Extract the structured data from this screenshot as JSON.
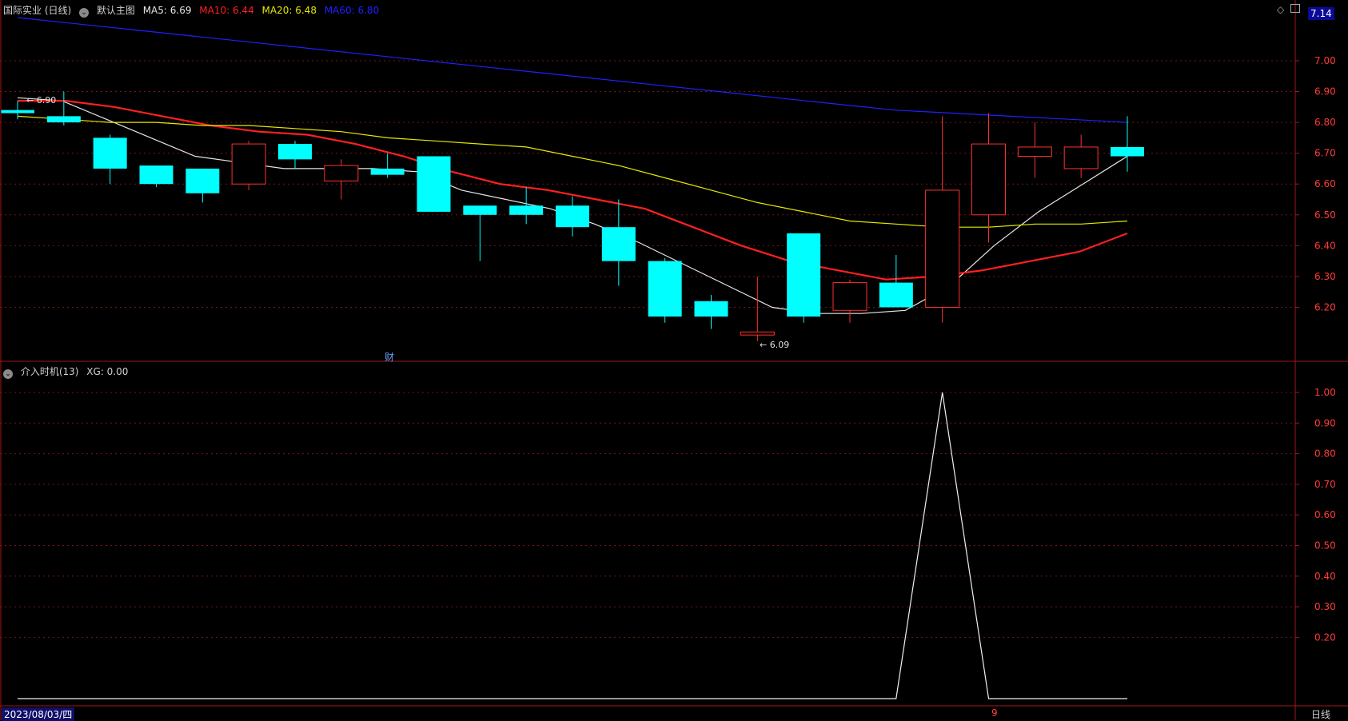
{
  "header": {
    "stock_label": "国际实业 (日线)",
    "main_label": "默认主图",
    "ma_items": [
      {
        "label": "MA5: 6.69",
        "color": "#e6e6e6"
      },
      {
        "label": "MA10: 6.44",
        "color": "#ff2020"
      },
      {
        "label": "MA20: 6.48",
        "color": "#e8e800"
      },
      {
        "label": "MA60: 6.80",
        "color": "#2020ff"
      }
    ],
    "corner_price": "7.14",
    "diamond_icon": "diamond-icon",
    "restore_icon": "window-restore-icon",
    "dropdown_icon": "chevron-down-icon"
  },
  "sub_header": {
    "indicator_label": "介入时机(13)",
    "xg_label": "XG: 0.00"
  },
  "footer": {
    "start_date": "2023/08/03/四",
    "month_marker": "9",
    "period_label": "日线"
  },
  "annotations": {
    "high_label": "6.90",
    "low_label": "6.09",
    "finance_marker": "财"
  },
  "colors": {
    "up": "#ff3030",
    "down": "#00ffff",
    "grid": "#7a1414",
    "axis": "#a01818",
    "ma5": "#e6e6e6",
    "ma10": "#ff2020",
    "ma20": "#e8e800",
    "ma60": "#2020ff"
  },
  "chart_data": [
    {
      "type": "candlestick",
      "title": "国际实业 (日线)",
      "ylim": [
        6.03,
        7.14
      ],
      "y_ticks": [
        6.2,
        6.3,
        6.4,
        6.5,
        6.6,
        6.7,
        6.8,
        6.9,
        7.0
      ],
      "candles": [
        {
          "o": 6.84,
          "h": 6.87,
          "l": 6.81,
          "c": 6.83
        },
        {
          "o": 6.82,
          "h": 6.9,
          "l": 6.79,
          "c": 6.8
        },
        {
          "o": 6.75,
          "h": 6.76,
          "l": 6.6,
          "c": 6.65
        },
        {
          "o": 6.66,
          "h": 6.66,
          "l": 6.59,
          "c": 6.6
        },
        {
          "o": 6.65,
          "h": 6.65,
          "l": 6.54,
          "c": 6.57
        },
        {
          "o": 6.6,
          "h": 6.74,
          "l": 6.58,
          "c": 6.73
        },
        {
          "o": 6.73,
          "h": 6.74,
          "l": 6.65,
          "c": 6.68
        },
        {
          "o": 6.61,
          "h": 6.68,
          "l": 6.55,
          "c": 6.66
        },
        {
          "o": 6.65,
          "h": 6.7,
          "l": 6.62,
          "c": 6.63
        },
        {
          "o": 6.69,
          "h": 6.69,
          "l": 6.51,
          "c": 6.51
        },
        {
          "o": 6.53,
          "h": 6.53,
          "l": 6.35,
          "c": 6.5
        },
        {
          "o": 6.53,
          "h": 6.59,
          "l": 6.47,
          "c": 6.5
        },
        {
          "o": 6.53,
          "h": 6.56,
          "l": 6.43,
          "c": 6.46
        },
        {
          "o": 6.46,
          "h": 6.55,
          "l": 6.27,
          "c": 6.35
        },
        {
          "o": 6.35,
          "h": 6.36,
          "l": 6.15,
          "c": 6.17
        },
        {
          "o": 6.22,
          "h": 6.24,
          "l": 6.13,
          "c": 6.17
        },
        {
          "o": 6.11,
          "h": 6.3,
          "l": 6.09,
          "c": 6.12
        },
        {
          "o": 6.44,
          "h": 6.44,
          "l": 6.15,
          "c": 6.17
        },
        {
          "o": 6.19,
          "h": 6.29,
          "l": 6.15,
          "c": 6.28
        },
        {
          "o": 6.28,
          "h": 6.37,
          "l": 6.2,
          "c": 6.2
        },
        {
          "o": 6.2,
          "h": 6.82,
          "l": 6.15,
          "c": 6.58
        },
        {
          "o": 6.5,
          "h": 6.83,
          "l": 6.41,
          "c": 6.73
        },
        {
          "o": 6.69,
          "h": 6.8,
          "l": 6.62,
          "c": 6.72
        },
        {
          "o": 6.65,
          "h": 6.76,
          "l": 6.62,
          "c": 6.72
        },
        {
          "o": 6.72,
          "h": 6.82,
          "l": 6.64,
          "c": 6.69
        }
      ],
      "series": [
        {
          "name": "MA5",
          "values": [
            6.88,
            6.87,
            6.81,
            6.75,
            6.69,
            6.67,
            6.65,
            6.65,
            6.65,
            6.64,
            6.58,
            6.55,
            6.52,
            6.47,
            6.41,
            6.34,
            6.27,
            6.2,
            6.18,
            6.18,
            6.19,
            6.27,
            6.4,
            6.51,
            6.6,
            6.69
          ]
        },
        {
          "name": "MA10",
          "values": [
            6.87,
            6.87,
            6.85,
            6.82,
            6.79,
            6.77,
            6.76,
            6.73,
            6.69,
            6.64,
            6.6,
            6.58,
            6.55,
            6.52,
            6.46,
            6.4,
            6.35,
            6.32,
            6.29,
            6.3,
            6.32,
            6.35,
            6.38,
            6.44
          ]
        },
        {
          "name": "MA20",
          "values": [
            6.82,
            6.81,
            6.8,
            6.8,
            6.79,
            6.79,
            6.78,
            6.77,
            6.75,
            6.74,
            6.73,
            6.72,
            6.69,
            6.66,
            6.62,
            6.58,
            6.54,
            6.51,
            6.48,
            6.47,
            6.46,
            6.46,
            6.47,
            6.47,
            6.48
          ]
        },
        {
          "name": "MA60",
          "values": [
            7.14,
            7.12,
            7.1,
            7.08,
            7.06,
            7.04,
            7.02,
            7.0,
            6.98,
            6.96,
            6.94,
            6.92,
            6.9,
            6.88,
            6.86,
            6.84,
            6.83,
            6.82,
            6.81,
            6.8
          ]
        }
      ]
    },
    {
      "type": "line",
      "title": "介入时机(13)",
      "ylim": [
        0,
        1.06
      ],
      "y_ticks": [
        0.2,
        0.3,
        0.4,
        0.5,
        0.6,
        0.7,
        0.8,
        0.9,
        1.0
      ],
      "series": [
        {
          "name": "XG",
          "values": [
            0,
            0,
            0,
            0,
            0,
            0,
            0,
            0,
            0,
            0,
            0,
            0,
            0,
            0,
            0,
            0,
            0,
            0,
            0,
            0,
            1,
            0,
            0,
            0,
            0
          ]
        }
      ]
    }
  ]
}
